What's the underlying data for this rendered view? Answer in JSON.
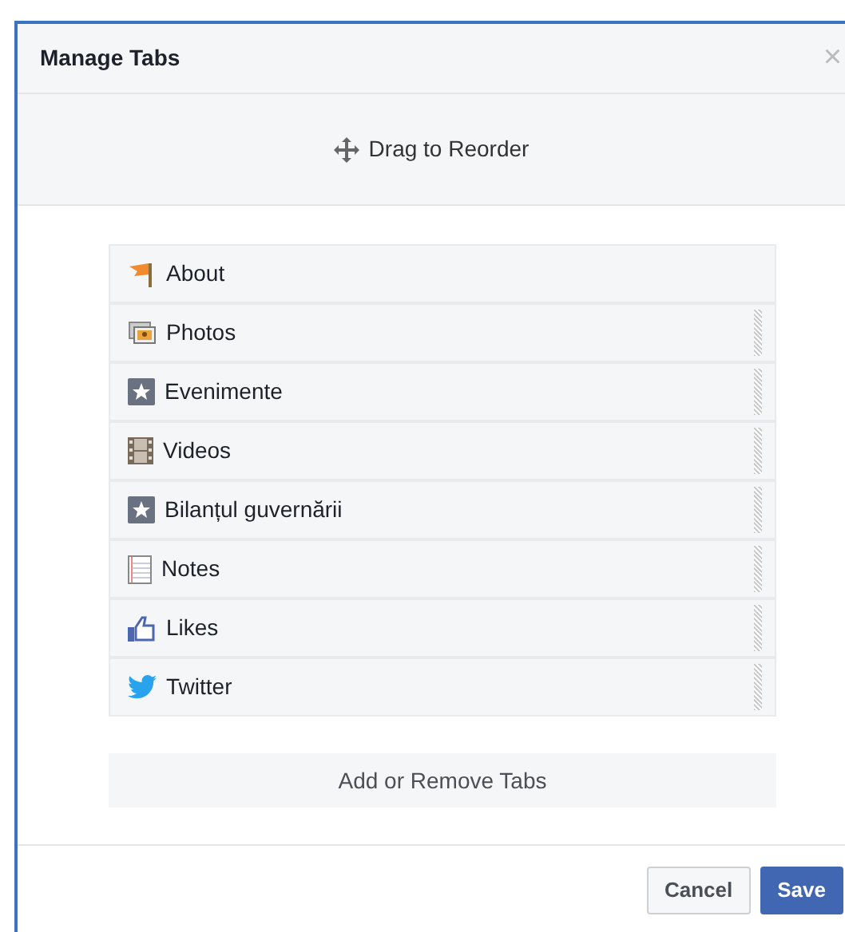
{
  "dialog": {
    "title": "Manage Tabs",
    "close": "×",
    "hint": "Drag to Reorder"
  },
  "tabs": [
    {
      "label": "About",
      "kind": "flag",
      "draggable": false
    },
    {
      "label": "Photos",
      "kind": "photo",
      "draggable": true
    },
    {
      "label": "Evenimente",
      "kind": "star",
      "draggable": true
    },
    {
      "label": "Videos",
      "kind": "film",
      "draggable": true
    },
    {
      "label": "Bilanțul guvernării",
      "kind": "star",
      "draggable": true
    },
    {
      "label": "Notes",
      "kind": "note",
      "draggable": true
    },
    {
      "label": "Likes",
      "kind": "like",
      "draggable": true
    },
    {
      "label": "Twitter",
      "kind": "bird",
      "draggable": true
    }
  ],
  "add_button": "Add or Remove Tabs",
  "buttons": [
    {
      "label": "Cancel",
      "kind": "secondary"
    },
    {
      "label": "Save",
      "kind": "primary"
    }
  ]
}
